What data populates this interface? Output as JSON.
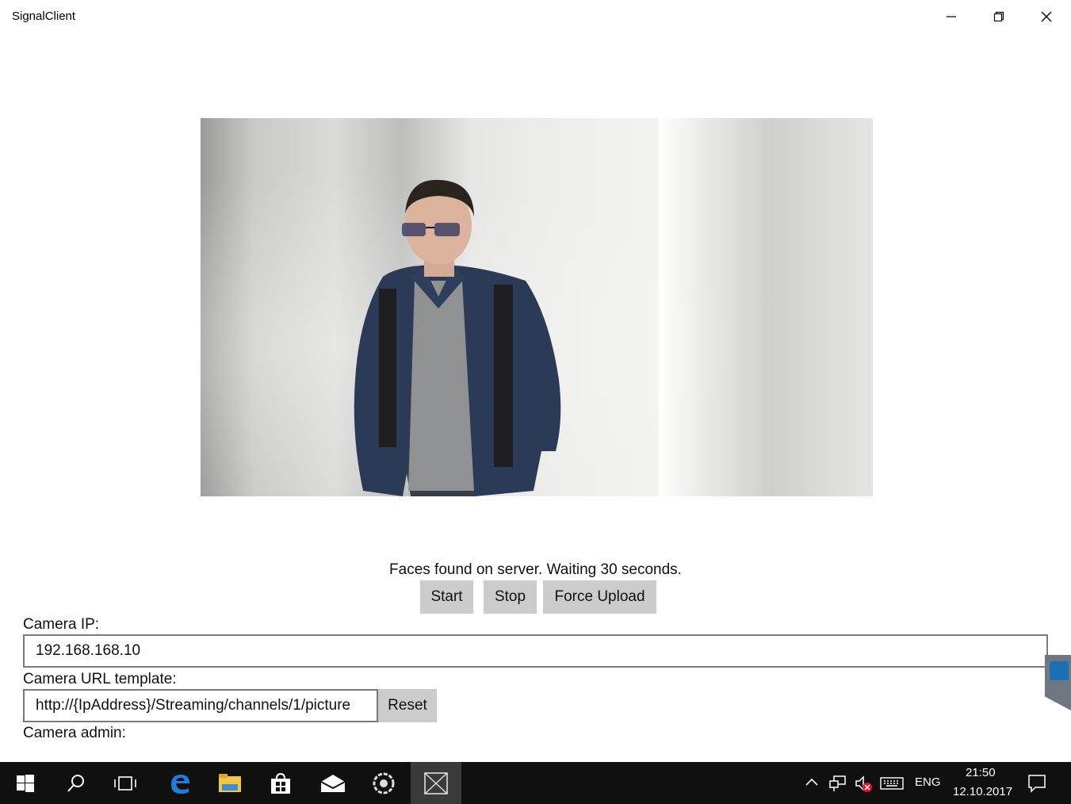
{
  "window": {
    "title": "SignalClient"
  },
  "caption_buttons": {
    "minimize": "minimize-icon",
    "restore": "restore-icon",
    "close": "close-icon"
  },
  "status": {
    "text": "Faces found on server. Waiting 30 seconds."
  },
  "controls": {
    "start_label": "Start",
    "stop_label": "Stop",
    "force_upload_label": "Force Upload"
  },
  "settings": {
    "camera_ip_label": "Camera IP:",
    "camera_ip_value": "192.168.168.10",
    "camera_url_label": "Camera URL template:",
    "camera_url_value": "http://{IpAddress}/Streaming/channels/1/picture",
    "reset_label": "Reset",
    "camera_admin_label": "Camera admin:"
  },
  "taskbar": {
    "items": [
      "start-icon",
      "search-icon",
      "task-view-icon",
      "edge-icon",
      "file-explorer-icon",
      "store-icon",
      "mail-icon",
      "app-icon",
      "signalclient-icon"
    ],
    "tray": {
      "language": "ENG",
      "time": "21:50",
      "date": "12.10.2017"
    }
  },
  "colors": {
    "taskbar_bg": "#101010",
    "button_bg": "#cccccc",
    "edge_blue": "#1e7fd8",
    "folder_yellow": "#f2c744"
  }
}
